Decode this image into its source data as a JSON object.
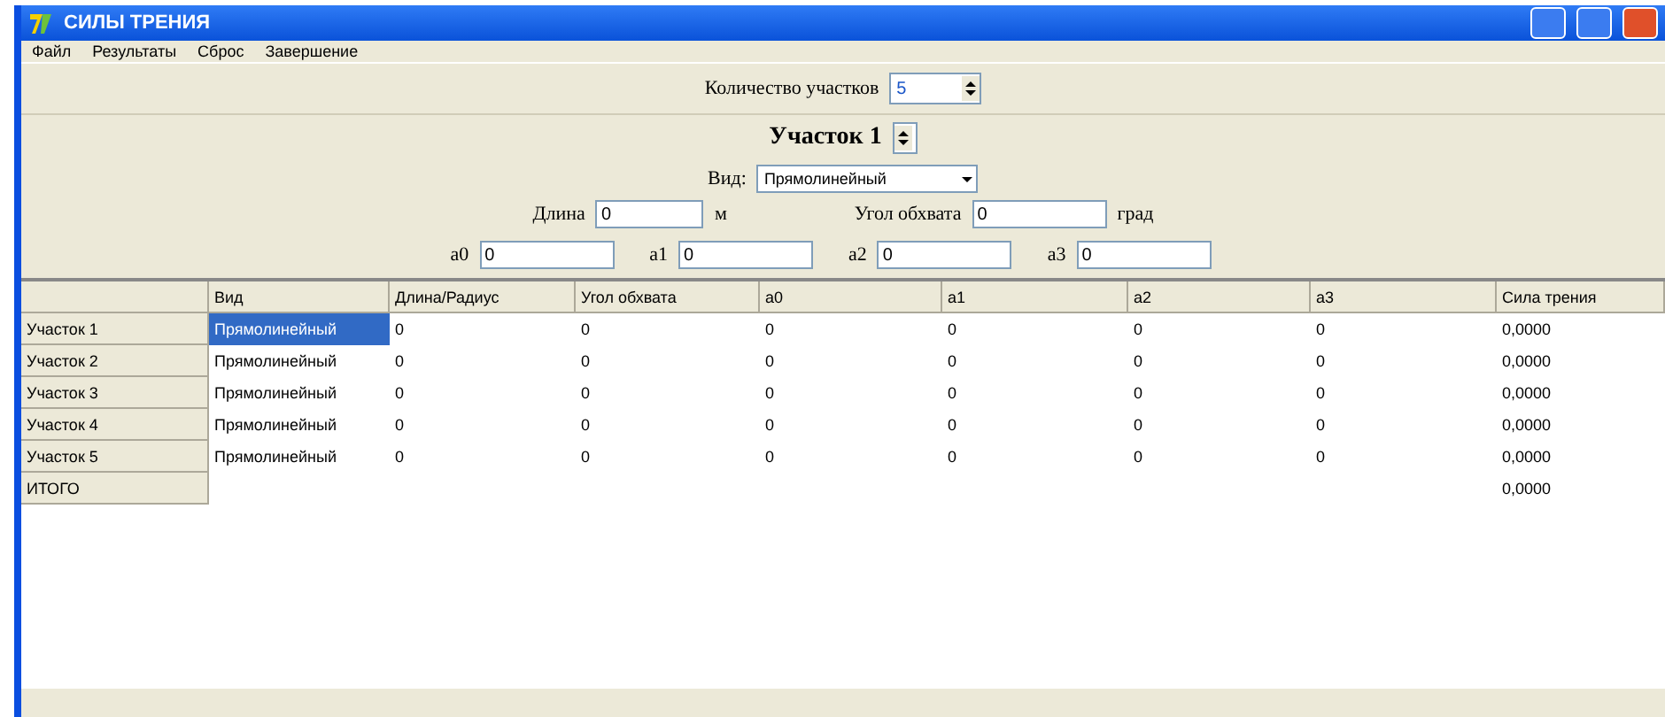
{
  "window": {
    "title": "СИЛЫ ТРЕНИЯ"
  },
  "menu": [
    "Файл",
    "Результаты",
    "Сброс",
    "Завершение"
  ],
  "count": {
    "label": "Количество участков",
    "value": "5"
  },
  "section": {
    "title": "Участок 1",
    "kind_label": "Вид:",
    "kind_value": "Прямолинейный",
    "length": {
      "label": "Длина",
      "value": "0",
      "unit": "м"
    },
    "angle": {
      "label": "Угол обхвата",
      "value": "0",
      "unit": "град"
    },
    "coefs": [
      {
        "label": "a0",
        "value": "0"
      },
      {
        "label": "a1",
        "value": "0"
      },
      {
        "label": "a2",
        "value": "0"
      },
      {
        "label": "a3",
        "value": "0"
      }
    ]
  },
  "table": {
    "columns": [
      "Вид",
      "Длина/Радиус",
      "Угол обхвата",
      "a0",
      "a1",
      "a2",
      "a3",
      "Сила трения"
    ],
    "rows": [
      {
        "header": "Участок 1",
        "cells": [
          "Прямолинейный",
          "0",
          "0",
          "0",
          "0",
          "0",
          "0",
          "0,0000"
        ],
        "selected": true
      },
      {
        "header": "Участок 2",
        "cells": [
          "Прямолинейный",
          "0",
          "0",
          "0",
          "0",
          "0",
          "0",
          "0,0000"
        ],
        "selected": false
      },
      {
        "header": "Участок 3",
        "cells": [
          "Прямолинейный",
          "0",
          "0",
          "0",
          "0",
          "0",
          "0",
          "0,0000"
        ],
        "selected": false
      },
      {
        "header": "Участок 4",
        "cells": [
          "Прямолинейный",
          "0",
          "0",
          "0",
          "0",
          "0",
          "0",
          "0,0000"
        ],
        "selected": false
      },
      {
        "header": "Участок 5",
        "cells": [
          "Прямолинейный",
          "0",
          "0",
          "0",
          "0",
          "0",
          "0",
          "0,0000"
        ],
        "selected": false
      }
    ],
    "total": {
      "header": "ИТОГО",
      "value": "0,0000"
    }
  }
}
